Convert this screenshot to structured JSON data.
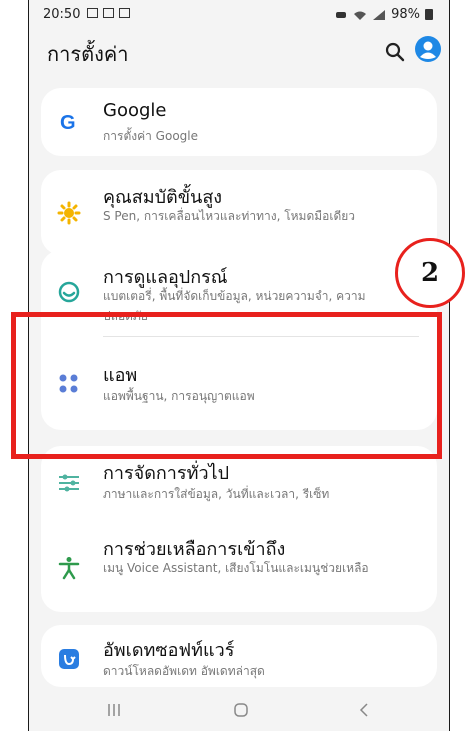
{
  "status_bar": {
    "time": "20:50",
    "battery": "98%"
  },
  "header": {
    "title": "การตั้งค่า"
  },
  "items": [
    {
      "title": "Google",
      "subtitle": "การตั้งค่า Google",
      "icon": "google-icon"
    },
    {
      "title": "คุณสมบัติขั้นสูง",
      "subtitle": "S Pen, การเคลื่อนไหวและท่าทาง, โหมดมือเดียว",
      "icon": "advanced-features-icon"
    },
    {
      "title": "การดูแลอุปกรณ์",
      "subtitle": "แบตเตอรี่, พื้นที่จัดเก็บข้อมูล, หน่วยความจำ, ความปลอดภัย",
      "icon": "device-care-icon"
    },
    {
      "title": "แอพ",
      "subtitle": "แอพพื้นฐาน, การอนุญาตแอพ",
      "icon": "apps-icon"
    },
    {
      "title": "การจัดการทั่วไป",
      "subtitle": "ภาษาและการใส่ข้อมูล, วันที่และเวลา, รีเซ็ท",
      "icon": "general-management-icon"
    },
    {
      "title": "การช่วยเหลือการเข้าถึง",
      "subtitle": "เมนู Voice Assistant, เสียงโมโนและเมนูช่วยเหลือ",
      "icon": "accessibility-icon"
    },
    {
      "title": "อัพเดทซอฟท์แวร์",
      "subtitle": "ดาวน์โหลดอัพเดท อัพเดทล่าสุด",
      "icon": "software-update-icon"
    }
  ],
  "annotation": {
    "step_number": "2",
    "color": "#e8211d"
  },
  "colors": {
    "accent": "#1e88e5",
    "background": "#f4f4f4"
  }
}
